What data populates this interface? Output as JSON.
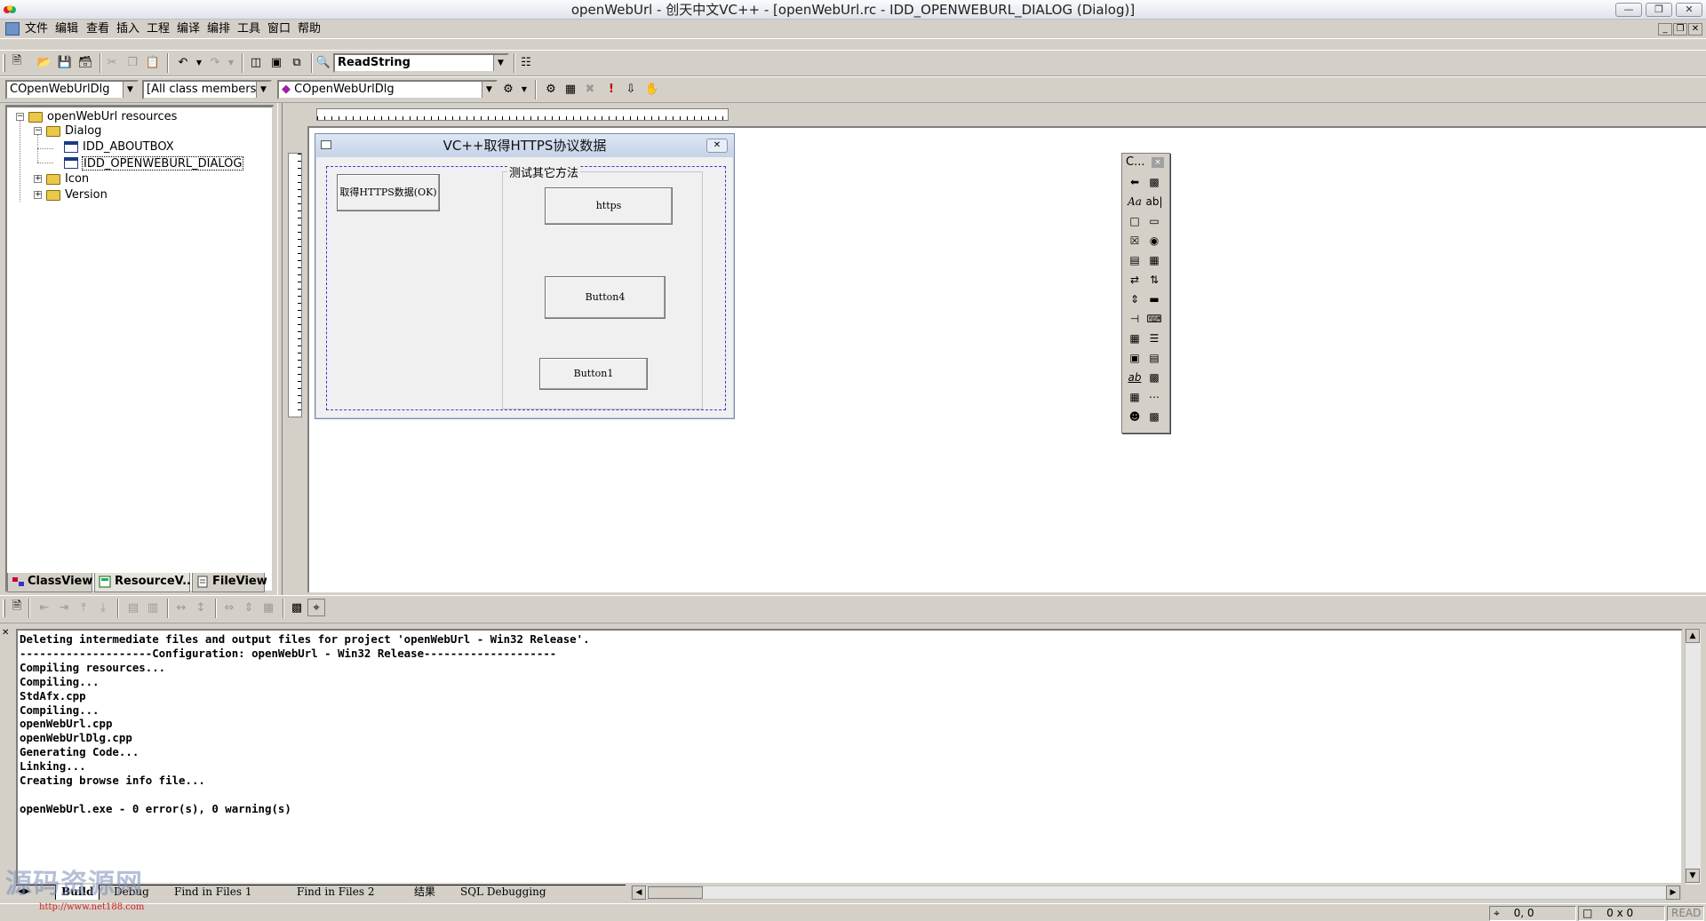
{
  "window": {
    "title": "openWebUrl - 创天中文VC++ - [openWebUrl.rc - IDD_OPENWEBURL_DIALOG (Dialog)]",
    "controls": [
      "minimize",
      "restore",
      "close"
    ]
  },
  "menu": {
    "items": [
      "文件",
      "编辑",
      "查看",
      "插入",
      "工程",
      "编译",
      "编排",
      "工具",
      "窗口",
      "帮助"
    ]
  },
  "toolbar": {
    "find_combo": "ReadString"
  },
  "wizardbar": {
    "class_combo": "COpenWebUrlDlg",
    "filter_combo": "[All class members]",
    "member_combo": "COpenWebUrlDlg"
  },
  "workspace": {
    "tree": {
      "root": "openWebUrl resources",
      "dialog_folder": "Dialog",
      "about_box": "IDD_ABOUTBOX",
      "main_dialog": "IDD_OPENWEBURL_DIALOG",
      "icon_folder": "Icon",
      "version_folder": "Version"
    },
    "tabs": [
      "ClassView",
      "ResourceV...",
      "FileView"
    ]
  },
  "dialog": {
    "title": "VC++取得HTTPS协议数据",
    "ok_button": "取得HTTPS数据(OK)",
    "group_label": "测试其它方法",
    "https_button": "https",
    "button4": "Button4",
    "button1": "Button1"
  },
  "palette": {
    "title": "C...",
    "close": "×"
  },
  "output": {
    "lines": [
      "Deleting intermediate files and output files for project 'openWebUrl - Win32 Release'.",
      "--------------------Configuration: openWebUrl - Win32 Release--------------------",
      "Compiling resources...",
      "Compiling...",
      "StdAfx.cpp",
      "Compiling...",
      "openWebUrl.cpp",
      "openWebUrlDlg.cpp",
      "Generating Code...",
      "Linking...",
      "Creating browse info file...",
      "",
      "openWebUrl.exe - 0 error(s), 0 warning(s)"
    ],
    "tabs": [
      "Build",
      "Debug",
      "Find in Files 1",
      "Find in Files 2",
      "结果",
      "SQL Debugging"
    ]
  },
  "statusbar": {
    "position": "0, 0",
    "size": "0 x 0",
    "mode": "READ"
  },
  "watermark": {
    "text": "源码资源网",
    "url": "http://www.net188.com"
  }
}
